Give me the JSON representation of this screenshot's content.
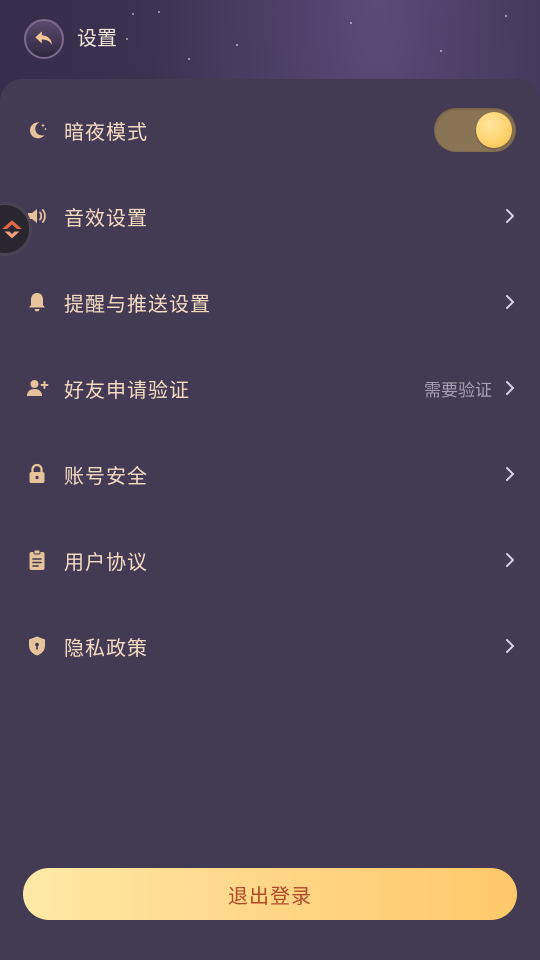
{
  "header": {
    "title": "设置"
  },
  "settings": {
    "dark_mode": {
      "label": "暗夜模式",
      "enabled": true
    },
    "items": [
      {
        "label": "音效设置",
        "value": ""
      },
      {
        "label": "提醒与推送设置",
        "value": ""
      },
      {
        "label": "好友申请验证",
        "value": "需要验证"
      },
      {
        "label": "账号安全",
        "value": ""
      },
      {
        "label": "用户协议",
        "value": ""
      },
      {
        "label": "隐私政策",
        "value": ""
      }
    ]
  },
  "logout": {
    "label": "退出登录"
  },
  "colors": {
    "accent": "#f2b64c",
    "panel": "#433a53",
    "label_text": "#f4dcc2",
    "logout_text": "#b04a2a"
  },
  "icons": {
    "back": "back-arrow-icon",
    "dark_mode": "moon-stars-icon",
    "sound": "speaker-icon",
    "notifications": "bell-icon",
    "friend_request": "add-user-icon",
    "account_security": "lock-icon",
    "user_agreement": "clipboard-icon",
    "privacy_policy": "shield-icon",
    "floating": "app-logo-icon"
  }
}
